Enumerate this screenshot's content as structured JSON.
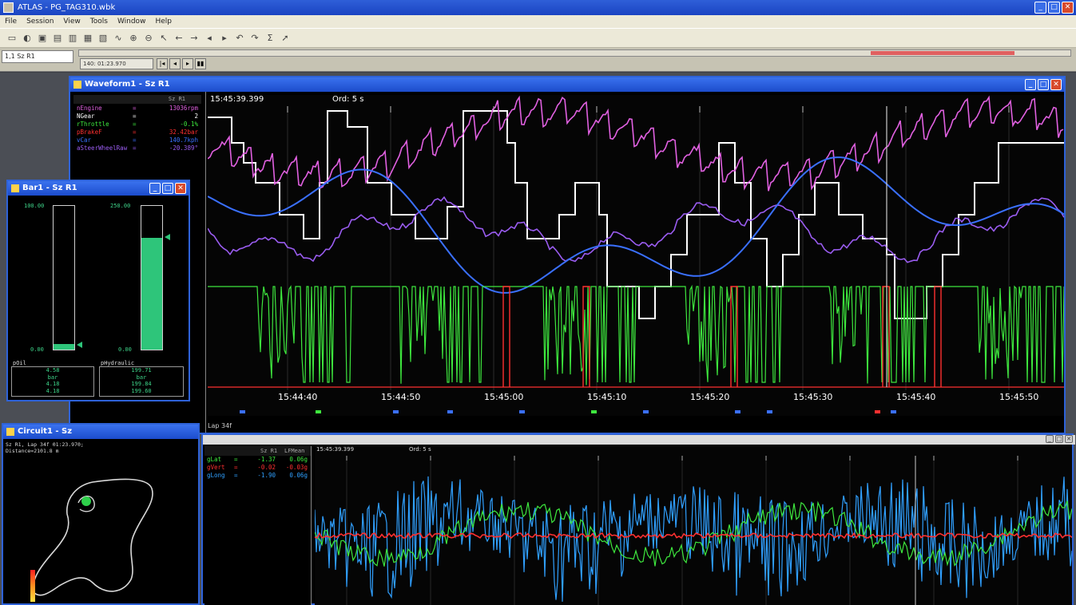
{
  "app": {
    "title": "ATLAS - PG_TAG310.wbk",
    "menu": [
      "File",
      "Session",
      "View",
      "Tools",
      "Window",
      "Help"
    ]
  },
  "subbar": {
    "session": "1,1 Sz R1",
    "lap": "140: 01:23.970"
  },
  "waveform": {
    "title": "Waveform1 - Sz R1",
    "cursor_time": "15:45:39.399",
    "cord": "Ord: 5 s",
    "lap_label": "Lap 34f",
    "param_header": "Sz R1",
    "params": [
      {
        "name": "nEngine",
        "eq": "=",
        "value": "13036rpm",
        "color": "#e060e0"
      },
      {
        "name": "NGear",
        "eq": "=",
        "value": "2",
        "color": "#ffffff"
      },
      {
        "name": "rThrottle",
        "eq": "=",
        "value": "-0.1%",
        "color": "#3ee83e"
      },
      {
        "name": "pBrakeF",
        "eq": "=",
        "value": "32.42bar",
        "color": "#ff3030"
      },
      {
        "name": "vCar",
        "eq": "=",
        "value": "140.7kph",
        "color": "#3a70ff"
      },
      {
        "name": "aSteerWheelRaw",
        "eq": "=",
        "value": "-20.389°",
        "color": "#9a5cf0"
      }
    ],
    "time_labels": [
      "15:44:40",
      "15:44:50",
      "15:45:00",
      "15:45:10",
      "15:45:20",
      "15:45:30",
      "15:45:40",
      "15:45:50"
    ]
  },
  "bar": {
    "title": "Bar1 - Sz R1",
    "gauges": [
      {
        "name": "pOil",
        "max": "100.00",
        "min": "0.00",
        "fill": 0.04,
        "values": [
          "4.58",
          "bar",
          "4.18",
          "4.18"
        ]
      },
      {
        "name": "pHydraulic",
        "max": "250.00",
        "min": "0.00",
        "fill": 0.78,
        "values": [
          "199.71",
          "bar",
          "199.84",
          "199.60"
        ]
      }
    ]
  },
  "circuit": {
    "title": "Circuit1 - Sz",
    "info_line1": "Sz R1, Lap 34f 01:23.970;",
    "info_line2": "Distance=2101.8 m"
  },
  "waveform2": {
    "cursor_time": "15:45:39.399",
    "cord": "Ord: 5 s",
    "col_name": "Sz R1",
    "col_value": "LFMean",
    "params": [
      {
        "name": "gLat",
        "eq": "=",
        "value": "-1.37",
        "value2": "0.06g",
        "color": "#3ee83e"
      },
      {
        "name": "gVert",
        "eq": "=",
        "value": "-0.02",
        "value2": "-0.03g",
        "color": "#ff3030"
      },
      {
        "name": "gLong",
        "eq": "=",
        "value": "-1.90",
        "value2": "0.06g",
        "color": "#30a0ff"
      }
    ]
  },
  "colors": {
    "rpm": "#e060e0",
    "gear": "#ffffff",
    "throttle": "#3ee83e",
    "brake": "#ff3030",
    "speed": "#3a70ff",
    "steer": "#9a5cf0",
    "glong": "#30a0ff"
  }
}
